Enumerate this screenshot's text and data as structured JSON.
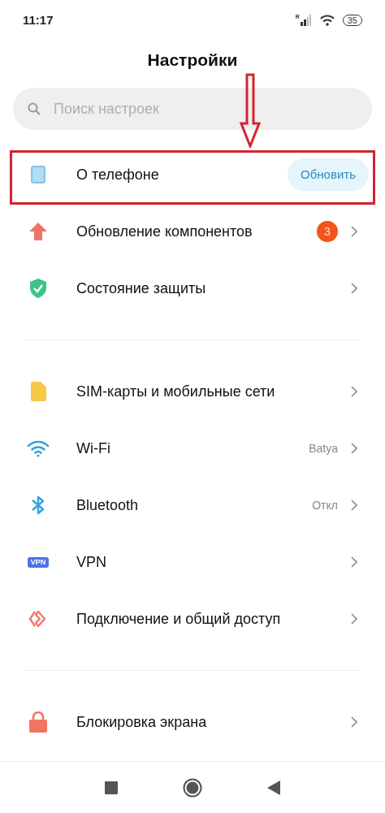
{
  "status_bar": {
    "time": "11:17",
    "signal_mark": "R",
    "battery": "35"
  },
  "title": "Настройки",
  "search": {
    "placeholder": "Поиск настроек"
  },
  "sections": [
    [
      {
        "label": "О телефоне",
        "highlighted": true,
        "button": "Обновить",
        "chevron": false
      },
      {
        "label": "Обновление компонентов",
        "highlighted": false,
        "badge": "3",
        "chevron": true
      },
      {
        "label": "Состояние защиты",
        "highlighted": false,
        "chevron": true
      }
    ],
    [
      {
        "label": "SIM-карты и мобильные сети",
        "highlighted": false,
        "chevron": true
      },
      {
        "label": "Wi-Fi",
        "highlighted": false,
        "value": "Batya",
        "chevron": true
      },
      {
        "label": "Bluetooth",
        "highlighted": false,
        "value": "Откл",
        "chevron": true
      },
      {
        "label": "VPN",
        "highlighted": false,
        "icon_text": "VPN",
        "chevron": true
      },
      {
        "label": "Подключение и общий доступ",
        "highlighted": false,
        "chevron": true
      }
    ],
    [
      {
        "label": "Блокировка экрана",
        "highlighted": false,
        "chevron": true
      }
    ]
  ]
}
